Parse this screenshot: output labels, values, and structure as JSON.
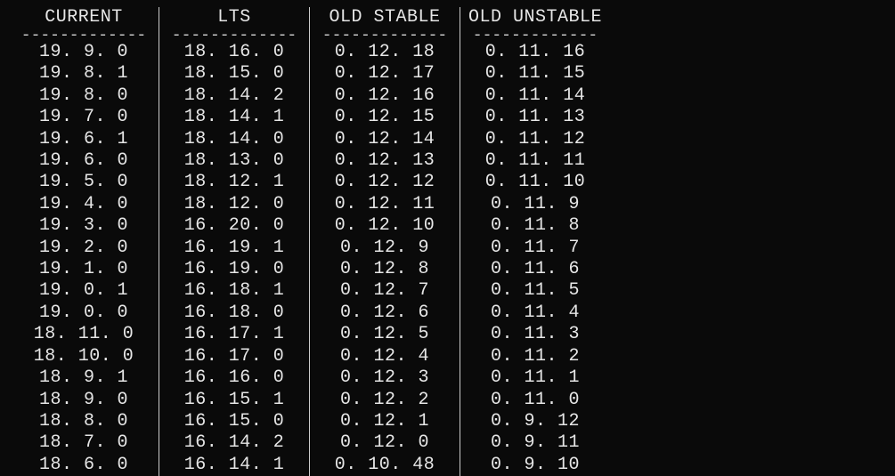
{
  "columns": [
    {
      "header": "CURRENT",
      "rows": [
        "19.9.0",
        "19.8.1",
        "19.8.0",
        "19.7.0",
        "19.6.1",
        "19.6.0",
        "19.5.0",
        "19.4.0",
        "19.3.0",
        "19.2.0",
        "19.1.0",
        "19.0.1",
        "19.0.0",
        "18.11.0",
        "18.10.0",
        "18.9.1",
        "18.9.0",
        "18.8.0",
        "18.7.0",
        "18.6.0"
      ]
    },
    {
      "header": "LTS",
      "rows": [
        "18.16.0",
        "18.15.0",
        "18.14.2",
        "18.14.1",
        "18.14.0",
        "18.13.0",
        "18.12.1",
        "18.12.0",
        "16.20.0",
        "16.19.1",
        "16.19.0",
        "16.18.1",
        "16.18.0",
        "16.17.1",
        "16.17.0",
        "16.16.0",
        "16.15.1",
        "16.15.0",
        "16.14.2",
        "16.14.1"
      ]
    },
    {
      "header": "OLD STABLE",
      "rows": [
        "0.12.18",
        "0.12.17",
        "0.12.16",
        "0.12.15",
        "0.12.14",
        "0.12.13",
        "0.12.12",
        "0.12.11",
        "0.12.10",
        "0.12.9",
        "0.12.8",
        "0.12.7",
        "0.12.6",
        "0.12.5",
        "0.12.4",
        "0.12.3",
        "0.12.2",
        "0.12.1",
        "0.12.0",
        "0.10.48"
      ]
    },
    {
      "header": "OLD UNSTABLE",
      "rows": [
        "0.11.16",
        "0.11.15",
        "0.11.14",
        "0.11.13",
        "0.11.12",
        "0.11.11",
        "0.11.10",
        "0.11.9",
        "0.11.8",
        "0.11.7",
        "0.11.6",
        "0.11.5",
        "0.11.4",
        "0.11.3",
        "0.11.2",
        "0.11.1",
        "0.11.0",
        "0.9.12",
        "0.9.11",
        "0.9.10"
      ]
    }
  ]
}
